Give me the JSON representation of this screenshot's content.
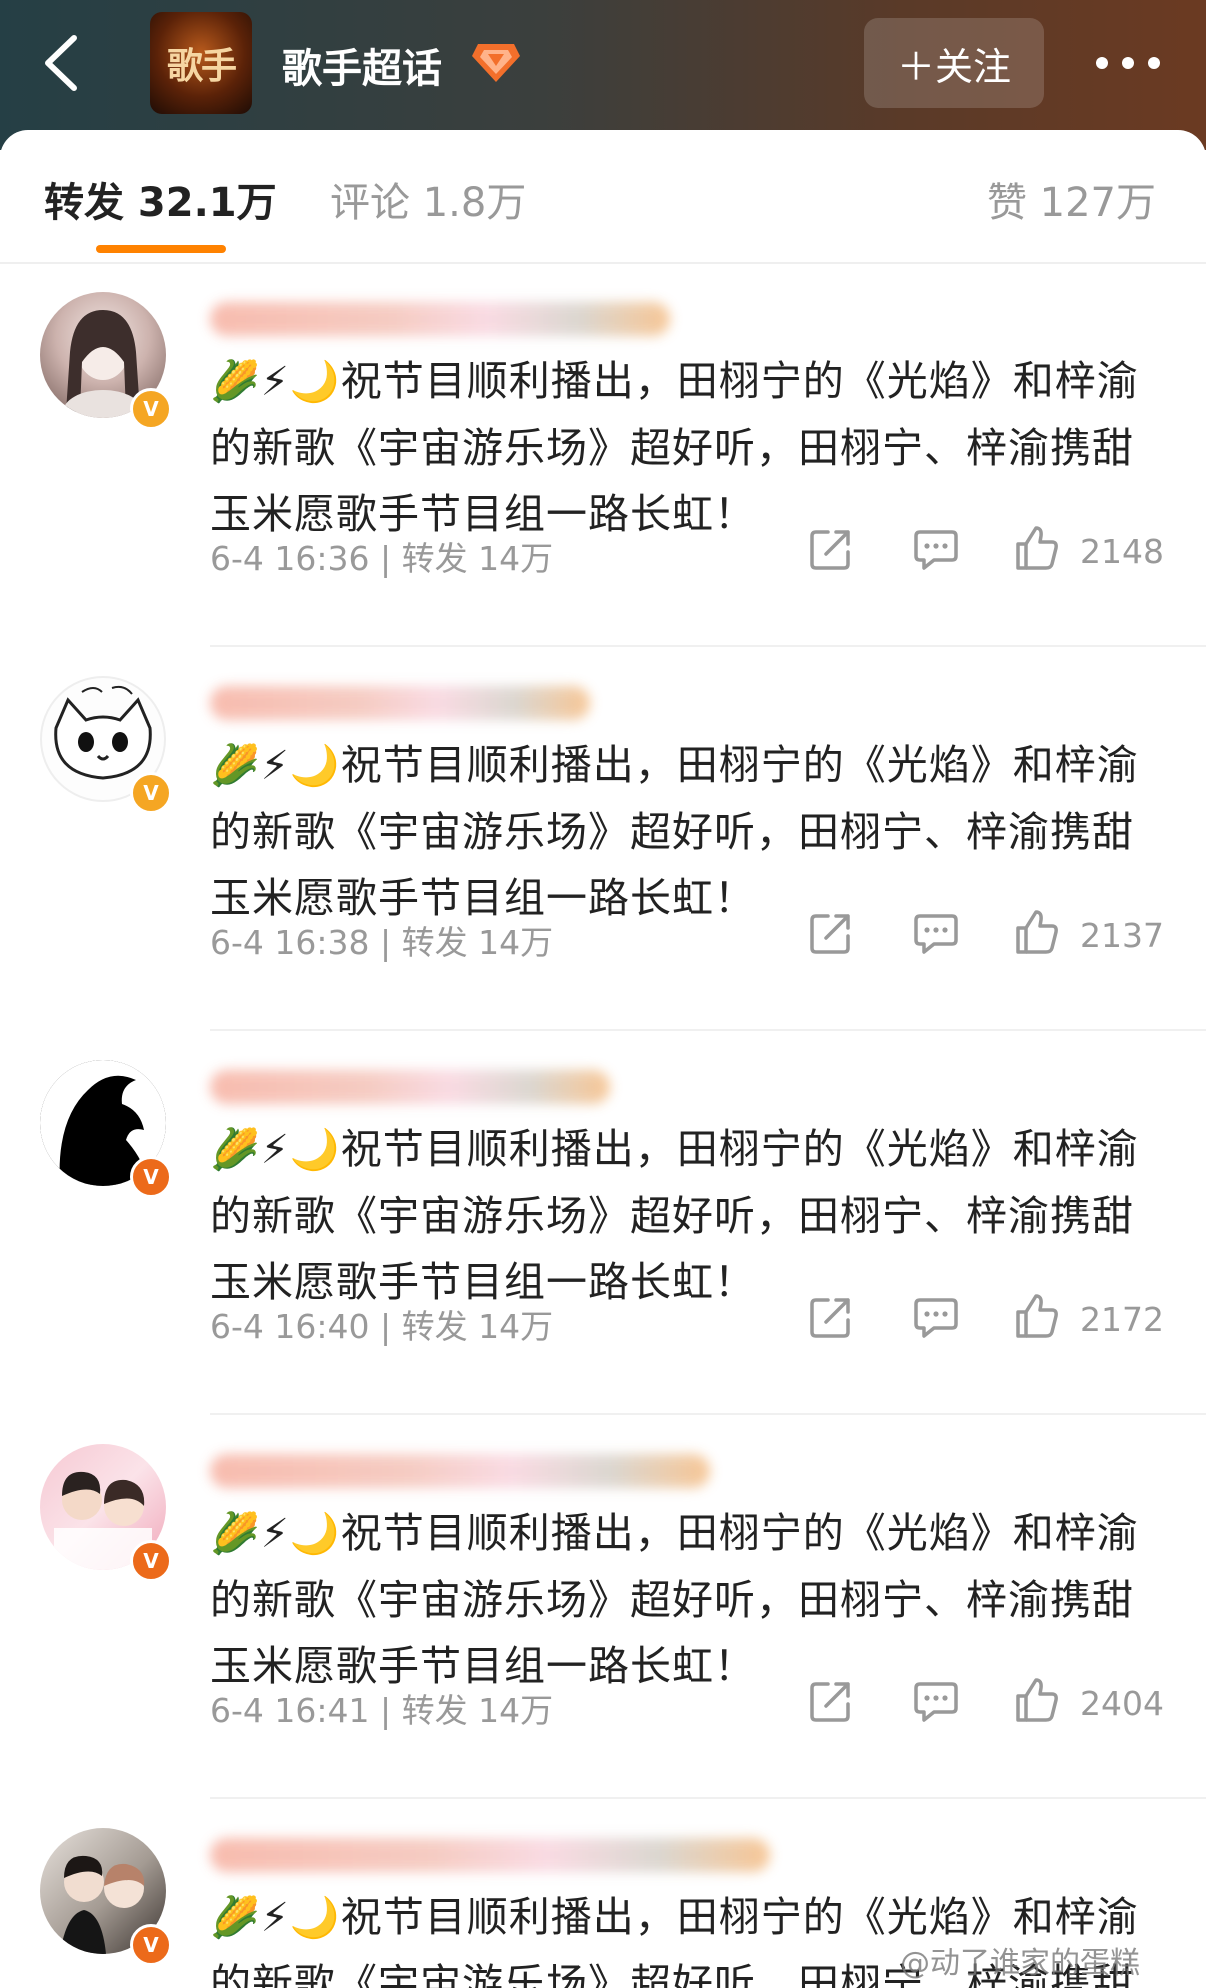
{
  "header": {
    "logo_text": "歌手",
    "title": "歌手超话",
    "follow_label": "＋关注"
  },
  "tabs": {
    "repost": "转发 32.1万",
    "comment": "评论 1.8万",
    "like": "赞 127万"
  },
  "posts": [
    {
      "emojis": "🌽⚡🌙",
      "text": "祝节目顺利播出，田栩宁的《光焰》和梓渝的新歌《宇宙游乐场》超好听，田栩宁、梓渝携甜玉米愿歌手节目组一路长虹！",
      "time": "6-4 16:36",
      "repost": "转发 14万",
      "likes": "2148"
    },
    {
      "emojis": "🌽⚡🌙",
      "text": "祝节目顺利播出，田栩宁的《光焰》和梓渝的新歌《宇宙游乐场》超好听，田栩宁、梓渝携甜玉米愿歌手节目组一路长虹！",
      "time": "6-4 16:38",
      "repost": "转发 14万",
      "likes": "2137"
    },
    {
      "emojis": "🌽⚡🌙",
      "text": "祝节目顺利播出，田栩宁的《光焰》和梓渝的新歌《宇宙游乐场》超好听，田栩宁、梓渝携甜玉米愿歌手节目组一路长虹！",
      "time": "6-4 16:40",
      "repost": "转发 14万",
      "likes": "2172"
    },
    {
      "emojis": "🌽⚡🌙",
      "text": "祝节目顺利播出，田栩宁的《光焰》和梓渝的新歌《宇宙游乐场》超好听，田栩宁、梓渝携甜玉米愿歌手节目组一路长虹！",
      "time": "6-4 16:41",
      "repost": "转发 14万",
      "likes": "2404"
    },
    {
      "emojis": "🌽⚡🌙",
      "text": "祝节目顺利播出，田栩宁的《光焰》和梓渝的新歌《宇宙游乐场》超好听，田栩宁、梓渝携甜玉米愿歌手节目组一路长虹！",
      "time": "",
      "repost": "",
      "likes": ""
    }
  ],
  "verify_mark": "V",
  "meta_separator": "|",
  "watermark": "@动了谁家的蛋糕",
  "colors": {
    "accent": "#ff8200",
    "verify": "#f5a623"
  }
}
